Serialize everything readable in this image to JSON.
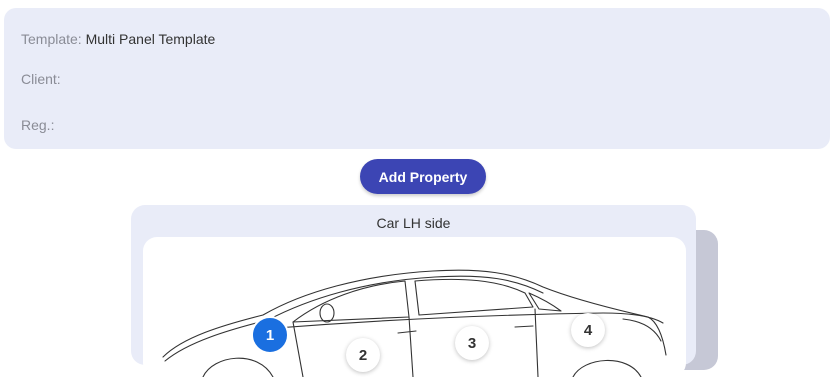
{
  "info": {
    "template_label": "Template:",
    "template_value": "Multi Panel Template",
    "client_label": "Client:",
    "reg_label": "Reg.:"
  },
  "actions": {
    "add_property": "Add Property"
  },
  "panel": {
    "title": "Car LH side",
    "markers": [
      "1",
      "2",
      "3",
      "4"
    ],
    "active_marker": "1"
  },
  "colors": {
    "panel_bg": "#e9ecf8",
    "button_bg": "#3c45b4",
    "active_marker": "#1a6fe0"
  }
}
